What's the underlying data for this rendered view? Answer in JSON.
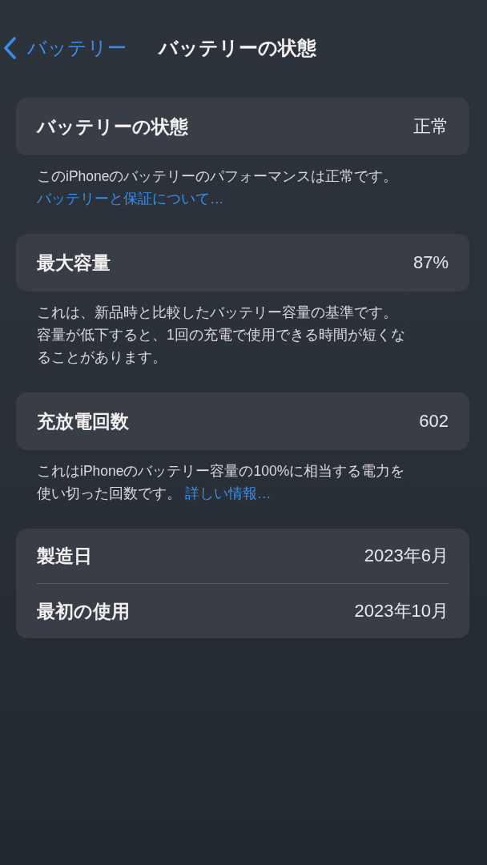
{
  "navigation": {
    "back_label": "バッテリー",
    "title": "バッテリーの状態"
  },
  "sections": [
    {
      "rows": [
        {
          "label": "バッテリーの状態",
          "value": "正常"
        }
      ],
      "footer": {
        "text": "このiPhoneのバッテリーのパフォーマンスは正常です。",
        "link": "バッテリーと保証について…"
      }
    },
    {
      "rows": [
        {
          "label": "最大容量",
          "value": "87%"
        }
      ],
      "footer": {
        "text": "これは、新品時と比較したバッテリー容量の基準です。容量が低下すると、1回の充電で使用できる時間が短くなることがあります。"
      }
    },
    {
      "rows": [
        {
          "label": "充放電回数",
          "value": "602"
        }
      ],
      "footer": {
        "text": "これはiPhoneのバッテリー容量の100%に相当する電力を使い切った回数です。",
        "link": "詳しい情報…"
      }
    },
    {
      "rows": [
        {
          "label": "製造日",
          "value": "2023年6月"
        },
        {
          "label": "最初の使用",
          "value": "2023年10月"
        }
      ]
    }
  ]
}
